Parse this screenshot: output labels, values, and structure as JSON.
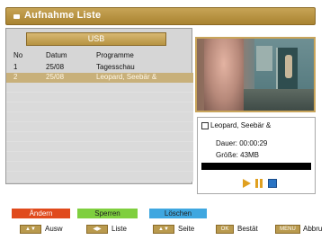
{
  "header": {
    "title": "Aufnahme Liste"
  },
  "list": {
    "device": "USB",
    "columns": {
      "no": "No",
      "date": "Datum",
      "program": "Programme"
    },
    "rows": [
      {
        "no": "1",
        "date": "25/08",
        "program": "Tagesschau"
      },
      {
        "no": "2",
        "date": "25/08",
        "program": "Leopard, Seebär &"
      }
    ]
  },
  "info": {
    "name": "Leopard, Seebär &",
    "duration": "Dauer: 00:00:29",
    "size": "Größe: 43MB"
  },
  "color_buttons": {
    "red": "Ändern",
    "green": "Sperren",
    "blue": "Löschen"
  },
  "hints": [
    {
      "key": "▲▼",
      "label": "Ausw"
    },
    {
      "key": "◀▶",
      "label": "Liste"
    },
    {
      "key": "▲▼",
      "label": "Seite"
    },
    {
      "key": "OK",
      "label": "Bestät"
    },
    {
      "key": "MENU",
      "label": "Abbru"
    }
  ]
}
